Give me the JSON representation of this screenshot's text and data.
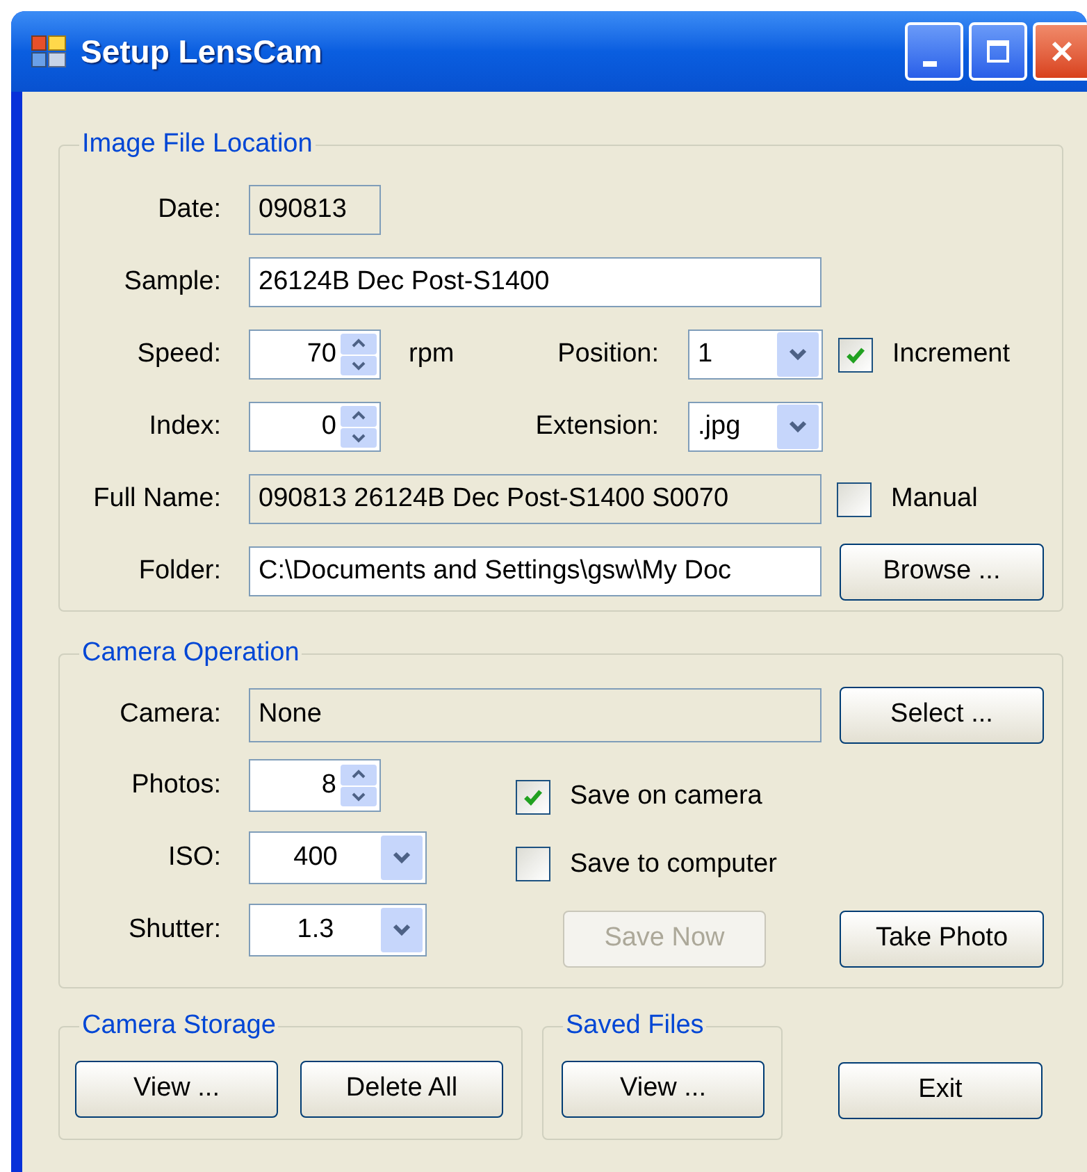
{
  "window": {
    "title": "Setup LensCam"
  },
  "image_file_location": {
    "title": "Image File Location",
    "date": {
      "label": "Date:",
      "value": "090813"
    },
    "sample": {
      "label": "Sample:",
      "value": "26124B Dec Post-S1400"
    },
    "speed": {
      "label": "Speed:",
      "value": "70",
      "unit": "rpm"
    },
    "position": {
      "label": "Position:",
      "value": "1"
    },
    "increment": {
      "label": "Increment",
      "checked": true
    },
    "index": {
      "label": "Index:",
      "value": "0"
    },
    "extension": {
      "label": "Extension:",
      "value": ".jpg"
    },
    "full_name": {
      "label": "Full Name:",
      "value": "090813 26124B Dec Post-S1400 S0070"
    },
    "manual": {
      "label": "Manual",
      "checked": false
    },
    "folder": {
      "label": "Folder:",
      "value": "C:\\Documents and Settings\\gsw\\My Doc"
    },
    "browse_button": {
      "label": "Browse ...",
      "disabled": false
    }
  },
  "camera_operation": {
    "title": "Camera Operation",
    "camera": {
      "label": "Camera:",
      "value": "None"
    },
    "select_button": {
      "label": "Select ...",
      "disabled": false
    },
    "photos": {
      "label": "Photos:",
      "value": "8"
    },
    "iso": {
      "label": "ISO:",
      "value": "400"
    },
    "shutter": {
      "label": "Shutter:",
      "value": "1.3"
    },
    "save_on_camera": {
      "label": "Save on camera",
      "checked": true
    },
    "save_to_computer": {
      "label": "Save to computer",
      "checked": false
    },
    "save_now_button": {
      "label": "Save Now",
      "disabled": true
    },
    "take_photo_button": {
      "label": "Take Photo",
      "disabled": false
    }
  },
  "camera_storage": {
    "title": "Camera Storage",
    "buttons": [
      {
        "label": "View ...",
        "disabled": false
      },
      {
        "label": "Delete All",
        "disabled": false
      }
    ]
  },
  "saved_files": {
    "title": "Saved Files",
    "buttons": [
      {
        "label": "View ...",
        "disabled": false
      }
    ]
  },
  "exit_button": {
    "label": "Exit",
    "disabled": false
  }
}
